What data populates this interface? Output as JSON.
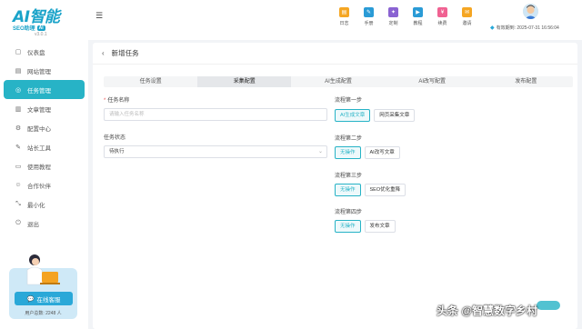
{
  "app": {
    "brand": "AI智能",
    "brand_sub": "SEO助理",
    "brand_tag": "AI",
    "version": "v3.0.1"
  },
  "sidebar": {
    "items": [
      {
        "label": "仪表盘",
        "icon": "dashboard-icon",
        "glyph": "▢"
      },
      {
        "label": "网站管理",
        "icon": "website-icon",
        "glyph": "▤"
      },
      {
        "label": "任务管理",
        "icon": "task-icon",
        "glyph": "◎",
        "active": true
      },
      {
        "label": "文章管理",
        "icon": "article-icon",
        "glyph": "▥"
      },
      {
        "label": "配置中心",
        "icon": "config-icon",
        "glyph": "⚙"
      },
      {
        "label": "站长工具",
        "icon": "tools-icon",
        "glyph": "✎"
      },
      {
        "label": "使用教程",
        "icon": "tutorial-icon",
        "glyph": "▭"
      },
      {
        "label": "合作伙伴",
        "icon": "partner-icon",
        "glyph": "☺"
      },
      {
        "label": "最小化",
        "icon": "minimize-icon",
        "glyph": "⤡"
      },
      {
        "label": "退出",
        "icon": "logout-icon",
        "glyph": "⏻"
      }
    ],
    "promo": {
      "button_label": "在线客服",
      "user_count": "用户总数: 2248 人"
    }
  },
  "header": {
    "tools": [
      {
        "label": "日志",
        "icon": "log-icon",
        "color": "#f5a623",
        "glyph": "▤"
      },
      {
        "label": "手册",
        "icon": "manual-icon",
        "color": "#2a9bd6",
        "glyph": "✎"
      },
      {
        "label": "定制",
        "icon": "custom-icon",
        "color": "#8a63d2",
        "glyph": "✦"
      },
      {
        "label": "教程",
        "icon": "tutorial-icon",
        "color": "#2a9bd6",
        "glyph": "▶"
      },
      {
        "label": "续费",
        "icon": "renew-icon",
        "color": "#f06292",
        "glyph": "¥"
      },
      {
        "label": "邀请",
        "icon": "invite-icon",
        "color": "#f5a623",
        "glyph": "✉"
      }
    ],
    "expire_text": "有效期到: 2025-07-31 16:56:04"
  },
  "page": {
    "title": "新增任务",
    "tabs": [
      {
        "label": "任务设置",
        "active": false
      },
      {
        "label": "采集配置",
        "active": true
      },
      {
        "label": "AI生成配置",
        "active": false
      },
      {
        "label": "AI改写配置",
        "active": false
      },
      {
        "label": "发布配置",
        "active": false
      }
    ],
    "task_name": {
      "label": "任务名称",
      "placeholder": "请输入任务名称",
      "value": ""
    },
    "task_status": {
      "label": "任务状态",
      "value": "待执行"
    },
    "steps": [
      {
        "label": "流程第一步",
        "options": [
          {
            "label": "AI生成文章",
            "selected": true
          },
          {
            "label": "网页采集文章",
            "selected": false
          }
        ]
      },
      {
        "label": "流程第二步",
        "options": [
          {
            "label": "无操作",
            "selected": true
          },
          {
            "label": "AI改写文章",
            "selected": false
          }
        ]
      },
      {
        "label": "流程第三步",
        "options": [
          {
            "label": "无操作",
            "selected": true
          },
          {
            "label": "SEO优化重降",
            "selected": false
          }
        ]
      },
      {
        "label": "流程第四步",
        "options": [
          {
            "label": "无操作",
            "selected": true
          },
          {
            "label": "发布文章",
            "selected": false
          }
        ]
      }
    ]
  },
  "watermark": "头条 @智慧数字乡村"
}
